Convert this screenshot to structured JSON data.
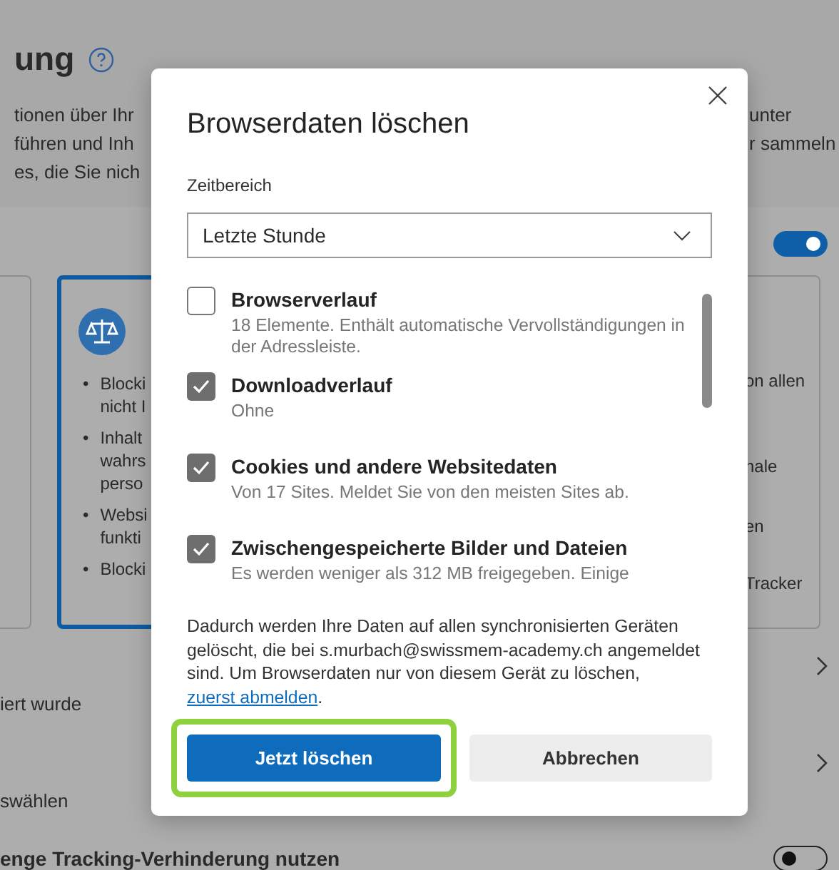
{
  "page": {
    "heading": "ung",
    "intro_left": [
      "tionen über Ihr",
      "führen und Inh",
      "es, die Sie nich"
    ],
    "intro_right": [
      "unter",
      "r sammeln"
    ],
    "top_toggle": {
      "on": true
    },
    "balanced_card": {
      "selected": true,
      "bullets": [
        {
          "marker": "•",
          "lines": [
            "Blocki",
            "nicht I"
          ]
        },
        {
          "marker": "•",
          "lines": [
            "Inhalt",
            "wahrs",
            "perso"
          ]
        },
        {
          "marker": "•",
          "lines": [
            "Websi",
            "funkti"
          ]
        },
        {
          "marker": "•",
          "lines": [
            "Blocki"
          ]
        }
      ]
    },
    "strict_card": {
      "lines": [
        "on allen",
        "nale",
        "en",
        "Tracker"
      ]
    },
    "rows": [
      {
        "label": "iert wurde"
      },
      {
        "label": "swählen"
      }
    ],
    "strict_toggle": {
      "label": "enge Tracking-Verhinderung nutzen",
      "on": false
    }
  },
  "dialog": {
    "title": "Browserdaten löschen",
    "time_range": {
      "label": "Zeitbereich",
      "value": "Letzte Stunde"
    },
    "items": [
      {
        "label": "Browserverlauf",
        "description": "18 Elemente. Enthält automatische Vervollständigungen in der Adressleiste.",
        "checked": false
      },
      {
        "label": "Downloadverlauf",
        "description": "Ohne",
        "checked": true
      },
      {
        "label": "Cookies und andere Websitedaten",
        "description": "Von 17 Sites. Meldet Sie von den meisten Sites ab.",
        "checked": true
      },
      {
        "label": "Zwischengespeicherte Bilder und Dateien",
        "description": "Es werden weniger als 312 MB freigegeben. Einige",
        "checked": true
      }
    ],
    "notice": "Dadurch werden Ihre Daten auf allen synchronisierten Geräten gelöscht, die bei s.murbach@swissmem-academy.ch angemeldet sind. Um Browserdaten nur von diesem Gerät zu löschen, ",
    "notice_link": "zuerst abmelden",
    "notice_end": ".",
    "primary_button": {
      "label": "Jetzt löschen",
      "highlighted": true
    },
    "secondary_button": {
      "label": "Abbrechen"
    }
  }
}
